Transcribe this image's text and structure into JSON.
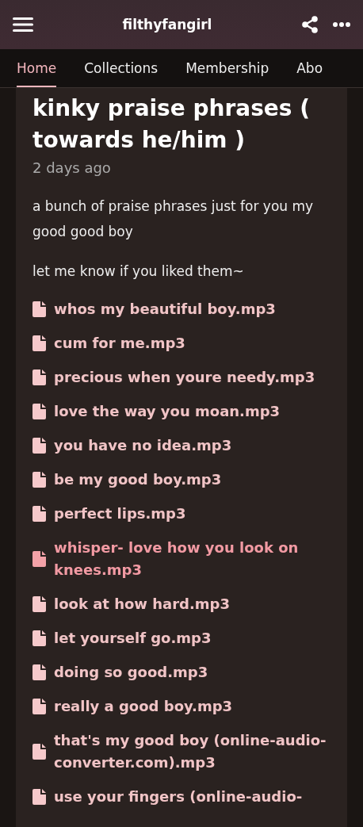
{
  "header": {
    "title": "filthyfangirl"
  },
  "tabs": [
    {
      "label": "Home",
      "selected": true
    },
    {
      "label": "Collections",
      "selected": false
    },
    {
      "label": "Membership",
      "selected": false
    },
    {
      "label": "Abo",
      "selected": false
    }
  ],
  "post": {
    "title": "kinky praise phrases ( towards he/him )",
    "time": "2 days ago",
    "paragraphs": [
      "a bunch of praise phrases just for you my good good boy",
      "let me know if you liked them~"
    ],
    "attachments": [
      {
        "name": "whos my beautiful boy.mp3",
        "highlighted": false
      },
      {
        "name": "cum for me.mp3",
        "highlighted": false
      },
      {
        "name": "precious when youre needy.mp3",
        "highlighted": false
      },
      {
        "name": "love the way you moan.mp3",
        "highlighted": false
      },
      {
        "name": "you have no idea.mp3",
        "highlighted": false
      },
      {
        "name": "be my good boy.mp3",
        "highlighted": false
      },
      {
        "name": "perfect lips.mp3",
        "highlighted": false
      },
      {
        "name": "whisper- love how you look on knees.mp3",
        "highlighted": true
      },
      {
        "name": "look at how hard.mp3",
        "highlighted": false
      },
      {
        "name": "let yourself go.mp3",
        "highlighted": false
      },
      {
        "name": "doing so good.mp3",
        "highlighted": false
      },
      {
        "name": "really a good boy.mp3",
        "highlighted": false
      },
      {
        "name": "that's my good boy (online-audio-converter.com).mp3",
        "highlighted": false
      },
      {
        "name": "use your fingers (online-audio-",
        "highlighted": false
      }
    ]
  }
}
